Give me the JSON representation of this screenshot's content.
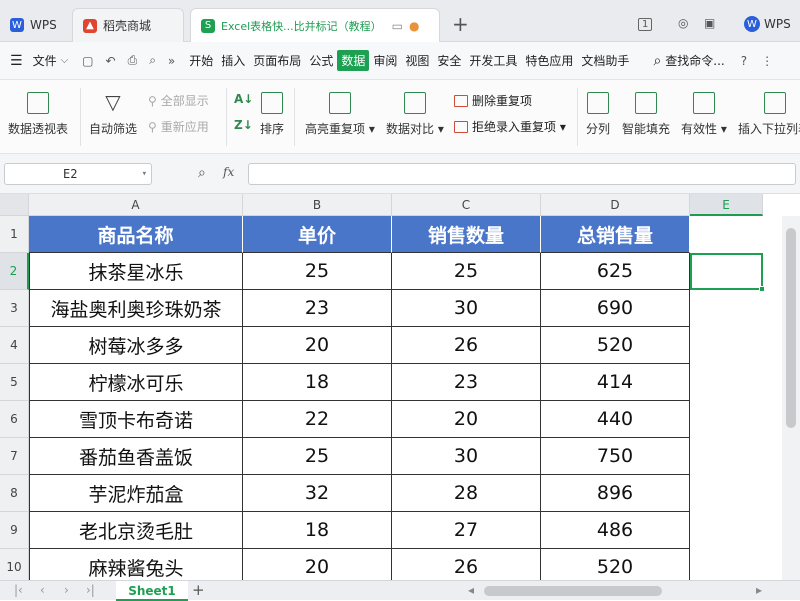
{
  "tabs": {
    "wps": "WPS",
    "shop": "稻壳商城",
    "doc": "Excel表格快...比并标记（教程）",
    "right_label": "WPS"
  },
  "menu": {
    "file": "文件",
    "items": [
      "开始",
      "插入",
      "页面布局",
      "公式",
      "数据",
      "审阅",
      "视图",
      "安全",
      "开发工具",
      "特色应用",
      "文档助手"
    ],
    "active": "数据",
    "search": "查找命令..."
  },
  "ribbon": {
    "pivot": "数据透视表",
    "autofilter": "自动筛选",
    "show_all": "全部显示",
    "reapply": "重新应用",
    "sort": "排序",
    "highlight_dup": "高亮重复项",
    "compare": "数据对比",
    "delete_dup": "删除重复项",
    "reject_dup": "拒绝录入重复项",
    "split": "分列",
    "smart_fill": "智能填充",
    "validity": "有效性",
    "insert_dropdown": "插入下拉列表"
  },
  "formula_bar": {
    "cell_ref": "E2",
    "fx": "fx",
    "value": ""
  },
  "grid": {
    "columns": [
      "A",
      "B",
      "C",
      "D",
      "E"
    ],
    "rows": [
      "1",
      "2",
      "3",
      "4",
      "5",
      "6",
      "7",
      "8",
      "9",
      "10"
    ],
    "headers": [
      "商品名称",
      "单价",
      "销售数量",
      "总销售量"
    ],
    "data": [
      [
        "抹茶星冰乐",
        "25",
        "25",
        "625"
      ],
      [
        "海盐奥利奥珍珠奶茶",
        "23",
        "30",
        "690"
      ],
      [
        "树莓冰多多",
        "20",
        "26",
        "520"
      ],
      [
        "柠檬冰可乐",
        "18",
        "23",
        "414"
      ],
      [
        "雪顶卡布奇诺",
        "22",
        "20",
        "440"
      ],
      [
        "番茄鱼香盖饭",
        "25",
        "30",
        "750"
      ],
      [
        "芋泥炸茄盒",
        "32",
        "28",
        "896"
      ],
      [
        "老北京烫毛肚",
        "18",
        "27",
        "486"
      ],
      [
        "麻辣酱兔头",
        "20",
        "26",
        "520"
      ]
    ]
  },
  "sheet": {
    "name": "Sheet1",
    "add": "+"
  },
  "colors": {
    "header_bg": "#4a76c9",
    "accent": "#1ea052"
  }
}
